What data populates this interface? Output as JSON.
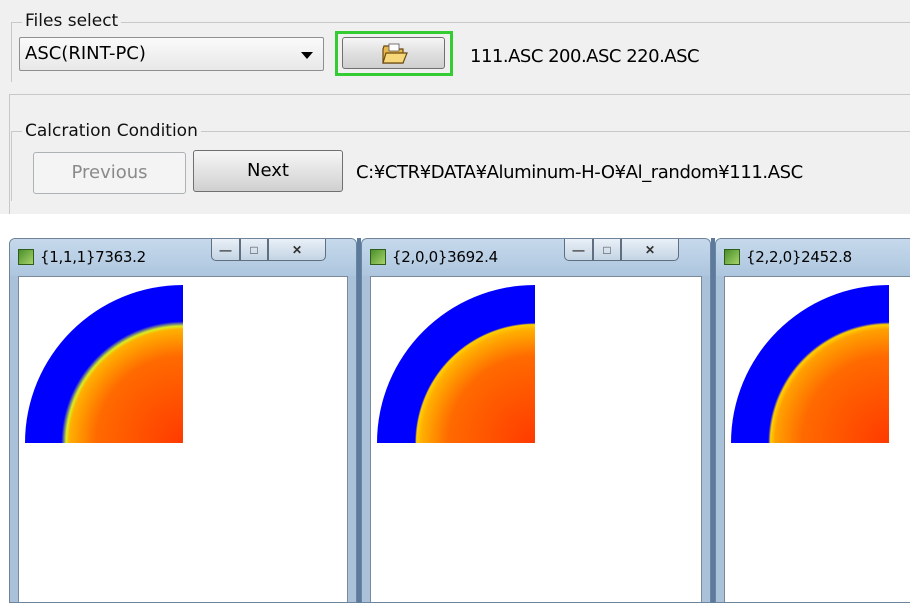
{
  "files_select": {
    "group_title": "Files select",
    "format_combo_value": "ASC(RINT-PC)",
    "open_button_icon": "open-folder-icon",
    "file_list": "111.ASC 200.ASC 220.ASC"
  },
  "calc_condition": {
    "group_title": "Calcration Condition",
    "previous_label": "Previous",
    "next_label": "Next",
    "current_path": "C:¥CTR¥DATA¥Aluminum-H-O¥Al_random¥111.ASC"
  },
  "windows": [
    {
      "title": "{1,1,1}7363.2"
    },
    {
      "title": "{2,0,0}3692.4"
    },
    {
      "title": "{2,2,0}2452.8"
    }
  ],
  "colors": {
    "highlight_outline": "#33cc33",
    "pole_ring": "#0000ff",
    "pole_center": "#ff4400",
    "pole_edge": "#ffcc00"
  }
}
